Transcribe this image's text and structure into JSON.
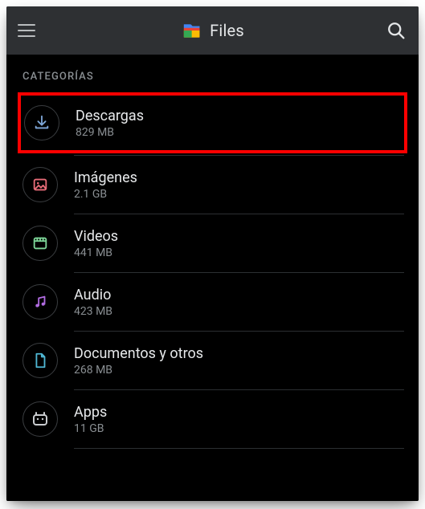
{
  "app": {
    "title": "Files"
  },
  "section": {
    "header": "CATEGORÍAS"
  },
  "categories": [
    {
      "label": "Descargas",
      "size": "829 MB",
      "icon": "download-icon",
      "color": "#7ea7d8",
      "highlighted": true
    },
    {
      "label": "Imágenes",
      "size": "2.1 GB",
      "icon": "image-icon",
      "color": "#e86c78",
      "highlighted": false
    },
    {
      "label": "Videos",
      "size": "441 MB",
      "icon": "video-icon",
      "color": "#7fd89a",
      "highlighted": false
    },
    {
      "label": "Audio",
      "size": "423 MB",
      "icon": "audio-icon",
      "color": "#b06be0",
      "highlighted": false
    },
    {
      "label": "Documentos y otros",
      "size": "268 MB",
      "icon": "document-icon",
      "color": "#4fb7d4",
      "highlighted": false
    },
    {
      "label": "Apps",
      "size": "11 GB",
      "icon": "apps-icon",
      "color": "#c9cccf",
      "highlighted": false
    }
  ]
}
